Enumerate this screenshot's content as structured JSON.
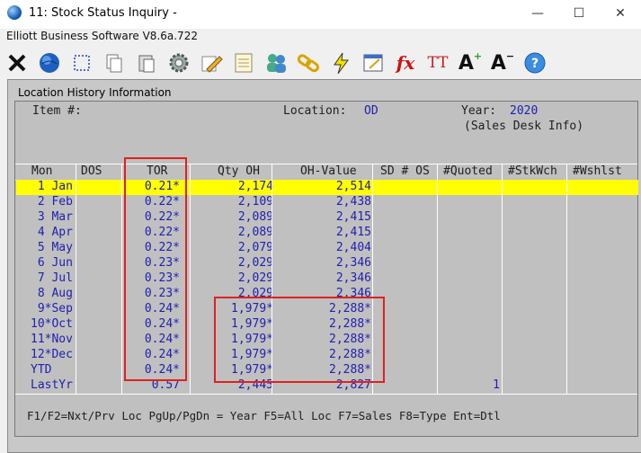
{
  "window": {
    "title": "11: Stock Status Inquiry -",
    "subtitle": "Elliott Business Software V8.6a.722",
    "minimize": "—",
    "maximize": "☐",
    "close": "✕"
  },
  "toolbar": {
    "icons": [
      "close-x-icon",
      "globe-icon",
      "select-box-icon",
      "copy-icon",
      "paste-icon",
      "settings-gear-icon",
      "edit-pencil-icon",
      "notepad-icon",
      "users-icon",
      "link-chain-icon",
      "lightning-icon",
      "window-edit-icon",
      "function-icon",
      "font-size-icon",
      "font-increase-icon",
      "font-decrease-icon",
      "help-icon"
    ],
    "fx_label": "fx",
    "tt_label": "TT",
    "a_label": "A",
    "help_label": "?"
  },
  "panel": {
    "title": "Location History Information",
    "item_label": "Item #:",
    "location_label": "Location:",
    "location_value": "OD",
    "year_label": "Year:",
    "year_value": "2020",
    "sales_desk": "(Sales Desk Info)",
    "footer": "F1/F2=Nxt/Prv Loc PgUp/PgDn = Year F5=All Loc F7=Sales F8=Type Ent=Dtl"
  },
  "table": {
    "headers": [
      "Mon",
      "DOS",
      "TOR",
      "Qty OH",
      "OH-Value",
      "SD # OS",
      "#Quoted",
      "#StkWch",
      "#Wshlst"
    ],
    "rows": [
      {
        "mon": " 1 Jan",
        "dos": "",
        "tor": "0.21*",
        "qty": "2,174",
        "val": "2,514",
        "sd": "",
        "quoted": "",
        "highlight": true
      },
      {
        "mon": " 2 Feb",
        "dos": "",
        "tor": "0.22*",
        "qty": "2,109",
        "val": "2,438",
        "sd": "",
        "quoted": ""
      },
      {
        "mon": " 3 Mar",
        "dos": "",
        "tor": "0.22*",
        "qty": "2,089",
        "val": "2,415",
        "sd": "",
        "quoted": ""
      },
      {
        "mon": " 4 Apr",
        "dos": "",
        "tor": "0.22*",
        "qty": "2,089",
        "val": "2,415",
        "sd": "",
        "quoted": ""
      },
      {
        "mon": " 5 May",
        "dos": "",
        "tor": "0.22*",
        "qty": "2,079",
        "val": "2,404",
        "sd": "",
        "quoted": ""
      },
      {
        "mon": " 6 Jun",
        "dos": "",
        "tor": "0.23*",
        "qty": "2,029",
        "val": "2,346",
        "sd": "",
        "quoted": ""
      },
      {
        "mon": " 7 Jul",
        "dos": "",
        "tor": "0.23*",
        "qty": "2,029",
        "val": "2,346",
        "sd": "",
        "quoted": ""
      },
      {
        "mon": " 8 Aug",
        "dos": "",
        "tor": "0.23*",
        "qty": "2,029",
        "val": "2,346",
        "sd": "",
        "quoted": ""
      },
      {
        "mon": " 9*Sep",
        "dos": "",
        "tor": "0.24*",
        "qty": "1,979*",
        "val": "2,288*",
        "sd": "",
        "quoted": ""
      },
      {
        "mon": "10*Oct",
        "dos": "",
        "tor": "0.24*",
        "qty": "1,979*",
        "val": "2,288*",
        "sd": "",
        "quoted": ""
      },
      {
        "mon": "11*Nov",
        "dos": "",
        "tor": "0.24*",
        "qty": "1,979*",
        "val": "2,288*",
        "sd": "",
        "quoted": ""
      },
      {
        "mon": "12*Dec",
        "dos": "",
        "tor": "0.24*",
        "qty": "1,979*",
        "val": "2,288*",
        "sd": "",
        "quoted": ""
      },
      {
        "mon": "YTD",
        "dos": "",
        "tor": "0.24*",
        "qty": "1,979*",
        "val": "2,288*",
        "sd": "",
        "quoted": ""
      },
      {
        "mon": "LastYr",
        "dos": "",
        "tor": "0.57",
        "qty": "2,445",
        "val": "2,827",
        "sd": "",
        "quoted": "1"
      }
    ]
  },
  "colors": {
    "highlight": "#ffff00",
    "value_text": "#2020b0",
    "annotation_box": "#e02020"
  }
}
